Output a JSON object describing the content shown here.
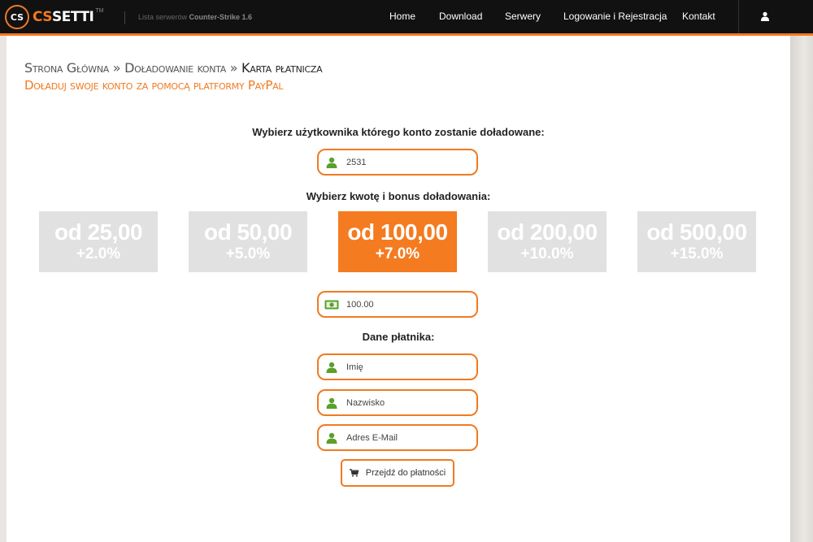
{
  "header": {
    "logo_badge": "CS",
    "logo_cs": "CS",
    "logo_setti": "SETTI",
    "logo_tm": "TM",
    "tagline_prefix": "Lista serwerów",
    "tagline_bold": "Counter-Strike 1.6",
    "nav": [
      "Home",
      "Download",
      "Serwery",
      "Logowanie i Rejestracja",
      "Kontakt"
    ],
    "user_icon": "user-icon"
  },
  "breadcrumb": {
    "home": "Strona Główna",
    "sep": " » ",
    "topup": "Doładowanie konta",
    "current": "Karta płatnicza"
  },
  "subtitle": "Doładuj swoje konto za pomocą platformy PayPal",
  "form": {
    "user_label": "Wybierz użytkownika którego konto zostanie doładowane:",
    "user_value": "2531",
    "amount_label": "Wybierz kwotę i bonus doładowania:",
    "amounts": [
      {
        "value": "od 25,00",
        "bonus": "+2.0%",
        "active": false
      },
      {
        "value": "od 50,00",
        "bonus": "+5.0%",
        "active": false
      },
      {
        "value": "od 100,00",
        "bonus": "+7.0%",
        "active": true
      },
      {
        "value": "od 200,00",
        "bonus": "+10.0%",
        "active": false
      },
      {
        "value": "od 500,00",
        "bonus": "+15.0%",
        "active": false
      }
    ],
    "amount_value": "100.00",
    "payer_label": "Dane płatnika:",
    "first_name_placeholder": "Imię",
    "last_name_placeholder": "Nazwisko",
    "email_placeholder": "Adres E-Mail",
    "submit_label": "Przejdź do płatności"
  },
  "colors": {
    "accent": "#f07a22",
    "active_amount": "#f47b20",
    "inactive_amount": "#e1e1e1",
    "icon_green": "#5aa02c",
    "topbar": "#111111"
  }
}
